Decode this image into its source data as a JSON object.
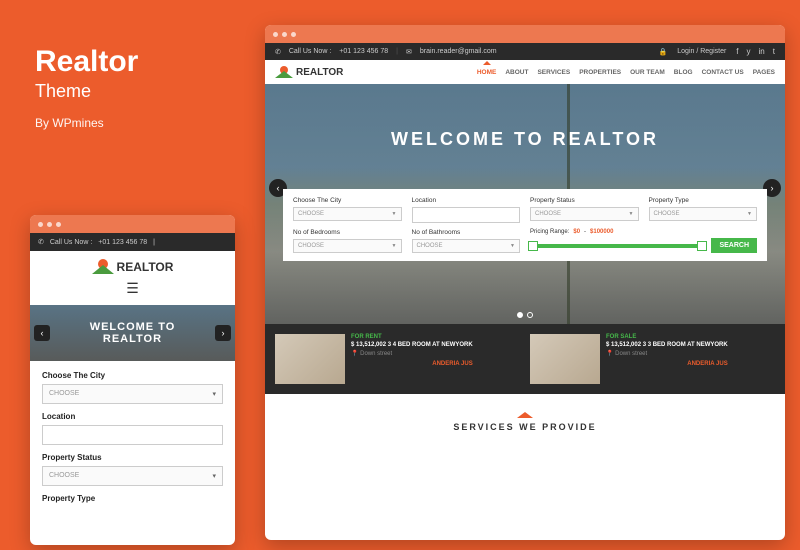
{
  "title": {
    "name": "Realtor",
    "sub": "Theme",
    "by": "By WPmines"
  },
  "topbar": {
    "call_label": "Call Us Now :",
    "phone": "+01 123 456 78",
    "email": "brain.reader@gmail.com",
    "login": "Login / Register"
  },
  "logo_text": "REALTOR",
  "nav": [
    "HOME",
    "ABOUT",
    "SERVICES",
    "PROPERTIES",
    "OUR TEAM",
    "BLOG",
    "CONTACT US",
    "PAGES"
  ],
  "hero_title": "WELCOME TO REALTOR",
  "search": {
    "city": "Choose The City",
    "location": "Location",
    "status": "Property Status",
    "type": "Property Type",
    "bedrooms": "No of Bedrooms",
    "bathrooms": "No of Bathrooms",
    "pricing": "Pricing Range:",
    "price_min": "$0",
    "price_max": "$100000",
    "choose": "CHOOSE",
    "button": "SEARCH"
  },
  "listings": [
    {
      "tag": "FOR RENT",
      "title": "$ 13,512,002 3 4 BED ROOM AT NEWYORK",
      "loc": "Down street",
      "author": "ANDERIA JUS"
    },
    {
      "tag": "FOR SALE",
      "title": "$ 13,512,002 3 3 BED ROOM AT NEWYORK",
      "loc": "Down street",
      "author": "ANDERIA JUS"
    }
  ],
  "services_h": "SERVICES WE PROVIDE",
  "mobile_phone": "+01 123 456 78",
  "m_ptype": "Property Type"
}
